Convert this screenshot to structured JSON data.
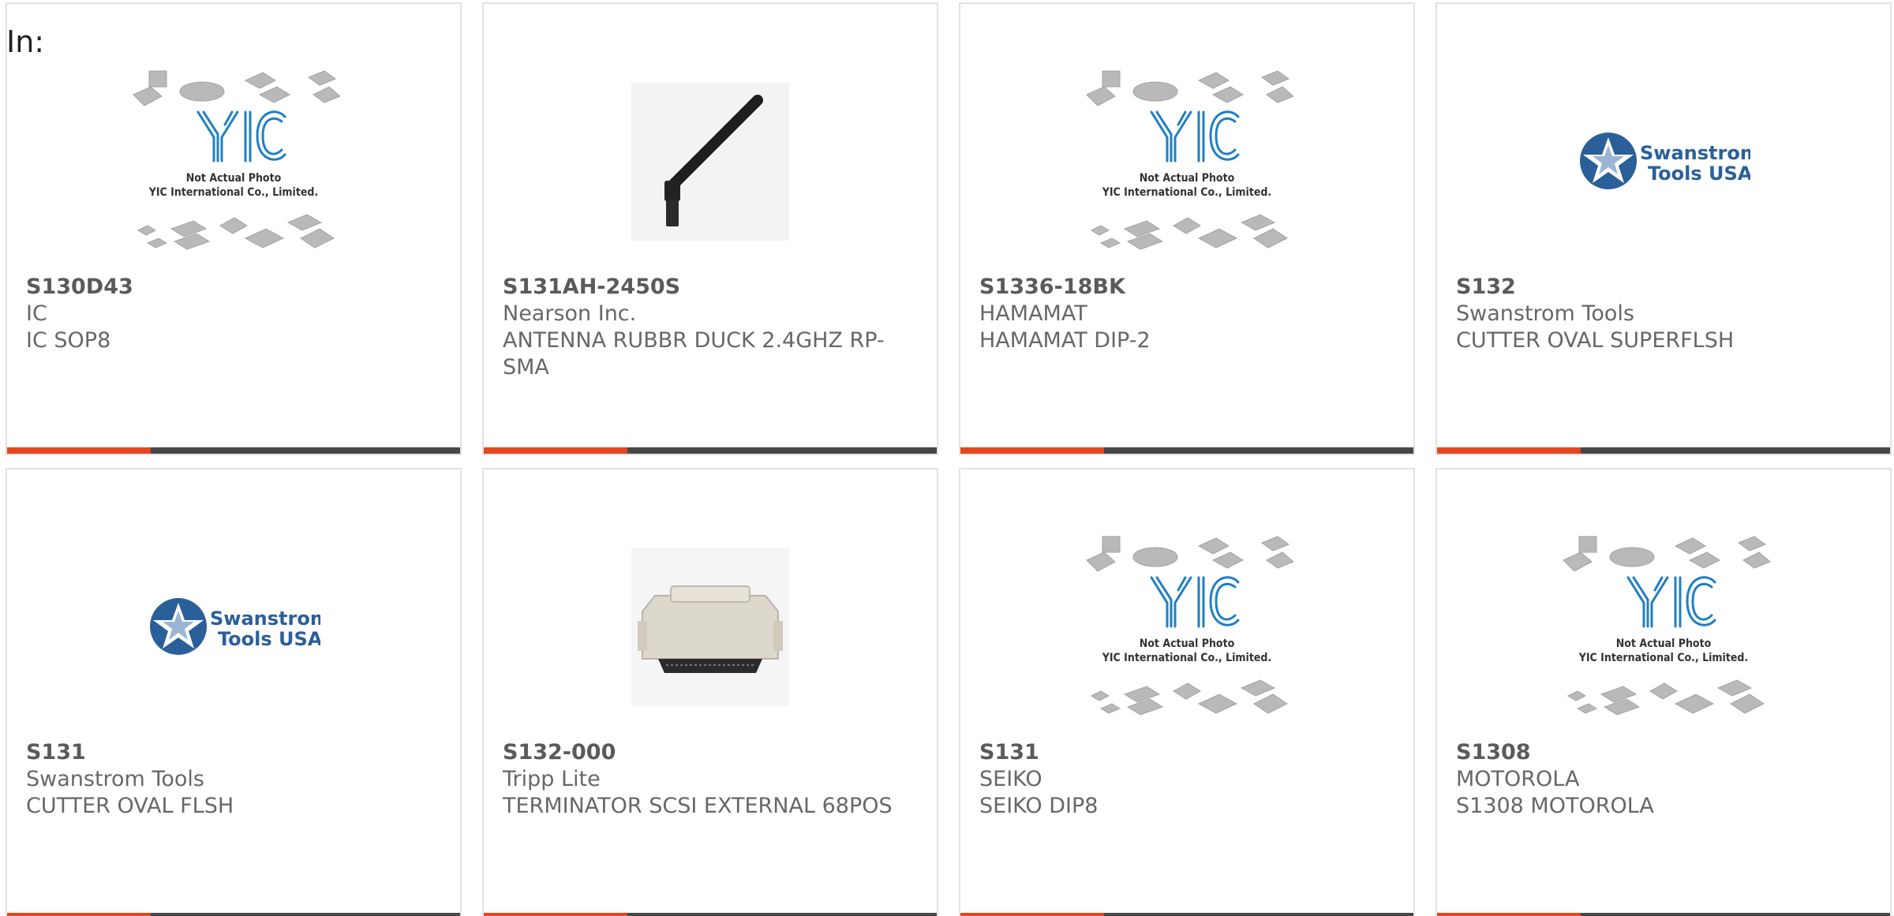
{
  "header": {
    "in_label": "In:"
  },
  "products": [
    {
      "part_number": "S130D43",
      "manufacturer": "IC",
      "description": "IC SOP8",
      "image": "yic-placeholder"
    },
    {
      "part_number": "S131AH-2450S",
      "manufacturer": "Nearson Inc.",
      "description": "ANTENNA RUBBR DUCK 2.4GHZ RP-SMA",
      "image": "antenna"
    },
    {
      "part_number": "S1336-18BK",
      "manufacturer": "HAMAMAT",
      "description": "HAMAMAT DIP-2",
      "image": "yic-placeholder"
    },
    {
      "part_number": "S132",
      "manufacturer": "Swanstrom Tools",
      "description": "CUTTER OVAL SUPERFLSH",
      "image": "swanstrom-logo"
    },
    {
      "part_number": "S131",
      "manufacturer": "Swanstrom Tools",
      "description": "CUTTER OVAL FLSH",
      "image": "swanstrom-logo"
    },
    {
      "part_number": "S132-000",
      "manufacturer": "Tripp Lite",
      "description": "TERMINATOR SCSI EXTERNAL 68POS",
      "image": "scsi-terminator"
    },
    {
      "part_number": "S131",
      "manufacturer": "SEIKO",
      "description": "SEIKO DIP8",
      "image": "yic-placeholder"
    },
    {
      "part_number": "S1308",
      "manufacturer": "MOTOROLA",
      "description": "S1308 MOTOROLA",
      "image": "yic-placeholder"
    }
  ],
  "placeholder_image": {
    "line1": "Not Actual Photo",
    "line2": "YIC International Co., Limited."
  },
  "swanstrom_logo": {
    "line1": "Swanstrom",
    "line2": "Tools USA"
  },
  "colors": {
    "accent": "#e3471e",
    "bar": "#474747",
    "text": "#676767",
    "border": "#e2e2e2",
    "yic_blue": "#1f7fc1",
    "swanstrom_blue": "#2a5f9a"
  }
}
